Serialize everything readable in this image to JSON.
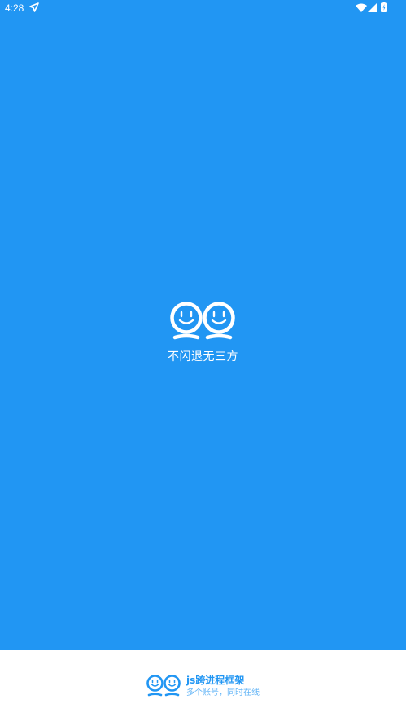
{
  "status_bar": {
    "time": "4:28"
  },
  "splash": {
    "tagline": "不闪退无三方"
  },
  "footer": {
    "title": "js跨进程框架",
    "subtitle": "多个账号，同时在线"
  },
  "colors": {
    "splash_background": "#2196F3",
    "footer_background": "#FFFFFF",
    "brand_text": "#2196F3",
    "subtitle_text": "#64B5F6"
  },
  "icons": {
    "status_left": "location-arrow-icon",
    "wifi": "wifi-icon",
    "signal": "signal-icon",
    "battery": "battery-icon",
    "logo": "smiley-faces-logo-icon"
  }
}
